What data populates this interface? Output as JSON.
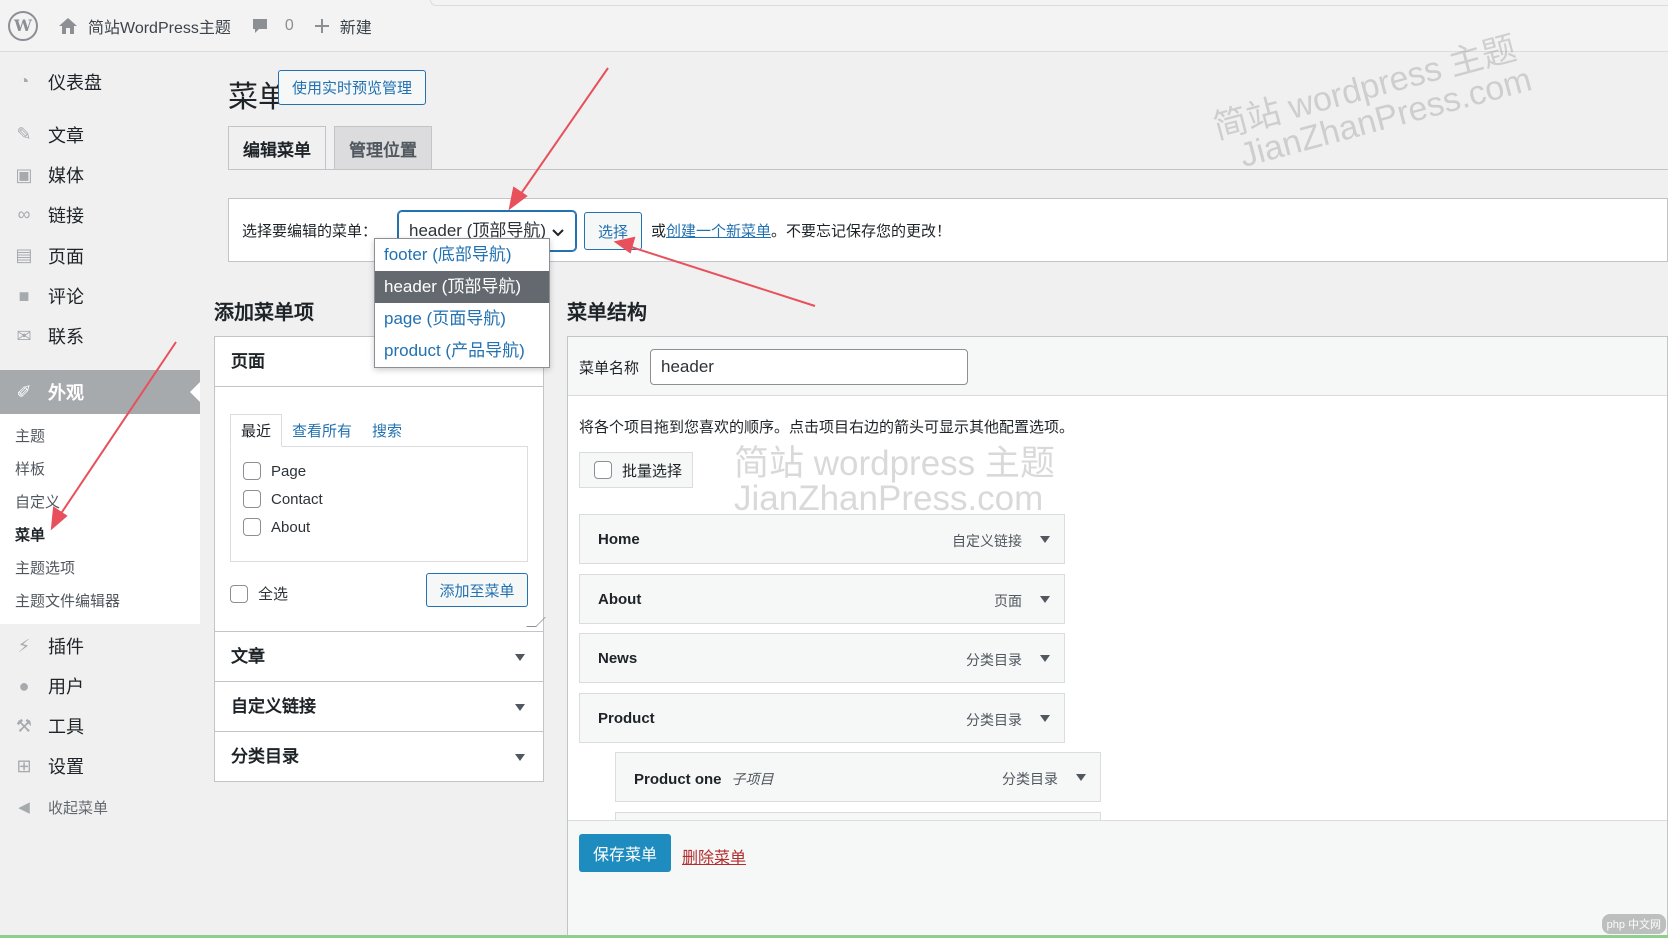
{
  "adminbar": {
    "site_name": "简站WordPress主题",
    "comments_count": "0",
    "new_label": "新建"
  },
  "sidebar": {
    "items_top": [
      {
        "label": "仪表盘",
        "icon": "dashboard-icon"
      },
      {
        "label": "文章",
        "icon": "pin-icon"
      },
      {
        "label": "媒体",
        "icon": "media-icon"
      },
      {
        "label": "链接",
        "icon": "link-icon"
      },
      {
        "label": "页面",
        "icon": "page-icon"
      },
      {
        "label": "评论",
        "icon": "comment-icon"
      },
      {
        "label": "联系",
        "icon": "mail-icon"
      }
    ],
    "current": {
      "label": "外观",
      "icon": "brush-icon"
    },
    "submenu": [
      "主题",
      "样板",
      "自定义",
      "菜单",
      "主题选项",
      "主题文件编辑器"
    ],
    "items_bottom": [
      {
        "label": "插件",
        "icon": "plugin-icon"
      },
      {
        "label": "用户",
        "icon": "user-icon"
      },
      {
        "label": "工具",
        "icon": "wrench-icon"
      },
      {
        "label": "设置",
        "icon": "settings-icon"
      }
    ],
    "collapse_label": "收起菜单"
  },
  "page": {
    "title": "菜单",
    "live_preview_button": "使用实时预览管理",
    "tabs": [
      "编辑菜单",
      "管理位置"
    ]
  },
  "select_menu": {
    "label": "选择要编辑的菜单：",
    "selected": "header (顶部导航)",
    "button": "选择",
    "or_text": "或",
    "create_link": "创建一个新菜单",
    "reminder": "。不要忘记保存您的更改！",
    "options": [
      "footer (底部导航)",
      "header (顶部导航)",
      "page (页面导航)",
      "product (产品导航)"
    ]
  },
  "add_items": {
    "title": "添加菜单项",
    "pages_panel": {
      "title": "页面",
      "tabs": [
        "最近",
        "查看所有",
        "搜索"
      ],
      "pages": [
        "Page",
        "Contact",
        "About"
      ],
      "select_all": "全选",
      "add_button": "添加至菜单"
    },
    "accordions": [
      "文章",
      "自定义链接",
      "分类目录"
    ]
  },
  "structure": {
    "title": "菜单结构",
    "name_label": "菜单名称",
    "name_value": "header",
    "instructions": "将各个项目拖到您喜欢的顺序。点击项目右边的箭头可显示其他配置选项。",
    "bulk_select": "批量选择",
    "items": [
      {
        "title": "Home",
        "type": "自定义链接",
        "sub": ""
      },
      {
        "title": "About",
        "type": "页面",
        "sub": ""
      },
      {
        "title": "News",
        "type": "分类目录",
        "sub": ""
      },
      {
        "title": "Product",
        "type": "分类目录",
        "sub": ""
      },
      {
        "title": "Product one",
        "type": "分类目录",
        "sub": "子项目"
      }
    ],
    "save_button": "保存菜单",
    "delete_link": "删除菜单"
  },
  "watermarks": {
    "top_line1": "简站 wordpress 主题",
    "top_line2": "JianZhanPress.com",
    "mid_line1": "简站 wordpress 主题",
    "mid_line2": "JianZhanPress.com"
  },
  "badge": "php 中文网",
  "colors": {
    "accent": "#2271b1",
    "save": "#1e8cbe",
    "delete": "#b32d2e",
    "annotation_arrow": "#e8505b"
  }
}
